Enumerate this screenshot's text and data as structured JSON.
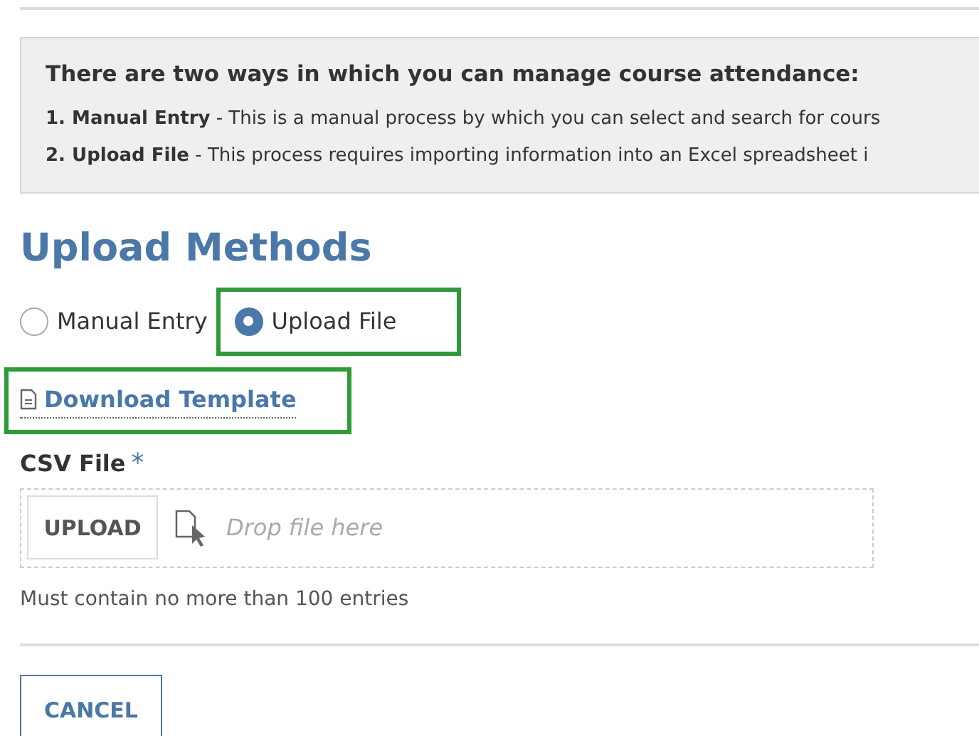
{
  "info_panel": {
    "title": "There are two ways in which you can manage course attendance:",
    "lines": [
      "**1. Manual Entry** - This is a manual process by which you can select and search for cours",
      "**2. Upload File** - This process requires importing information into an Excel spreadsheet i"
    ]
  },
  "section_title": "Upload Methods",
  "methods": [
    {
      "label": "Manual Entry",
      "selected": false,
      "highlighted": false
    },
    {
      "label": "Upload File",
      "selected": true,
      "highlighted": true
    }
  ],
  "template_link": {
    "label": "Download Template",
    "highlighted": true
  },
  "csv_field": {
    "label": "CSV File",
    "required_mark": "*",
    "button": "UPLOAD",
    "placeholder": "Drop file here",
    "hint": "Must contain no more than 100 entries"
  },
  "cancel_button": "CANCEL"
}
